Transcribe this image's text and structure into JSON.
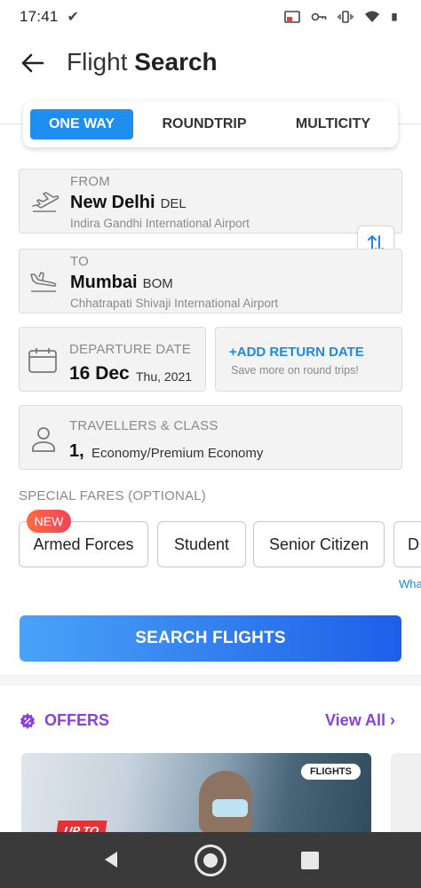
{
  "status_bar": {
    "time": "17:41"
  },
  "header": {
    "title_light": "Flight",
    "title_bold": "Search"
  },
  "tabs": [
    {
      "label": "ONE WAY",
      "active": true
    },
    {
      "label": "ROUNDTRIP",
      "active": false
    },
    {
      "label": "MULTICITY",
      "active": false
    }
  ],
  "from": {
    "label": "FROM",
    "city": "New Delhi",
    "code": "DEL",
    "airport": "Indira Gandhi International Airport"
  },
  "to": {
    "label": "TO",
    "city": "Mumbai",
    "code": "BOM",
    "airport": "Chhatrapati Shivaji International Airport"
  },
  "departure": {
    "label": "DEPARTURE DATE",
    "date": "16 Dec",
    "day_year": "Thu, 2021"
  },
  "return": {
    "title": "+ADD RETURN DATE",
    "subtitle": "Save more on round trips!"
  },
  "travellers": {
    "label": "TRAVELLERS & CLASS",
    "count": "1,",
    "class": "Economy/Premium Economy"
  },
  "special_fares": {
    "label": "SPECIAL FARES (OPTIONAL)",
    "badge": "NEW",
    "chips": [
      "Armed Forces",
      "Student",
      "Senior Citizen",
      "D"
    ],
    "link": "Wha"
  },
  "search_button": "SEARCH FLIGHTS",
  "offers": {
    "label": "OFFERS",
    "view_all": "View All",
    "card_tag": "FLIGHTS",
    "card_badge": "UP TO"
  },
  "colors": {
    "primary_blue": "#1e8ef0",
    "offers_purple": "#8a3fe0",
    "badge_red": "#f2435b"
  }
}
